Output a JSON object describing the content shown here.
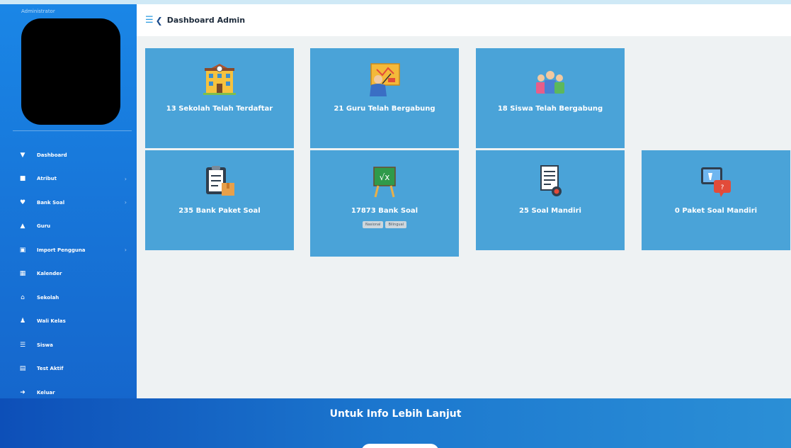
{
  "header": {
    "title": "Dashboard Admin"
  },
  "sidebar": {
    "user_label": "Administrator",
    "menu": [
      {
        "label": "Dashboard",
        "icon": "dashboard-icon",
        "has_submenu": false
      },
      {
        "label": "Atribut",
        "icon": "atribut-icon",
        "has_submenu": true
      },
      {
        "label": "Bank Soal",
        "icon": "bank-soal-icon",
        "has_submenu": true
      },
      {
        "label": "Guru",
        "icon": "guru-icon",
        "has_submenu": false
      },
      {
        "label": "Import Pengguna",
        "icon": "import-icon",
        "has_submenu": true
      },
      {
        "label": "Kalender",
        "icon": "calendar-icon",
        "has_submenu": false
      },
      {
        "label": "Sekolah",
        "icon": "school-icon",
        "has_submenu": false
      },
      {
        "label": "Wali Kelas",
        "icon": "wali-kelas-icon",
        "has_submenu": false
      },
      {
        "label": "Siswa",
        "icon": "siswa-icon",
        "has_submenu": false
      },
      {
        "label": "Test Aktif",
        "icon": "test-aktif-icon",
        "has_submenu": false
      },
      {
        "label": "Keluar",
        "icon": "logout-icon",
        "has_submenu": false
      }
    ]
  },
  "cards": [
    {
      "label": "13 Sekolah Telah Terdaftar",
      "icon": "school-building-icon"
    },
    {
      "label": "21 Guru Telah Bergabung",
      "icon": "teacher-board-icon"
    },
    {
      "label": "18 Siswa Telah Bergabung",
      "icon": "students-group-icon"
    },
    {
      "label": "235 Bank Paket Soal",
      "icon": "clipboard-package-icon"
    },
    {
      "label": "17873 Bank Soal",
      "icon": "chalkboard-sqrt-icon",
      "badges": [
        "Nasional",
        "Bilingual"
      ]
    },
    {
      "label": "25 Soal Mandiri",
      "icon": "document-stamp-icon"
    },
    {
      "label": "0 Paket Soal Mandiri",
      "icon": "chat-bubbles-icon"
    }
  ],
  "footer": {
    "info": "Untuk Info Lebih Lanjut"
  },
  "colors": {
    "sidebar": "#1a86e6",
    "card": "#4aa3d8",
    "main_bg": "#eef2f3",
    "footer": "#0d4fb8"
  }
}
